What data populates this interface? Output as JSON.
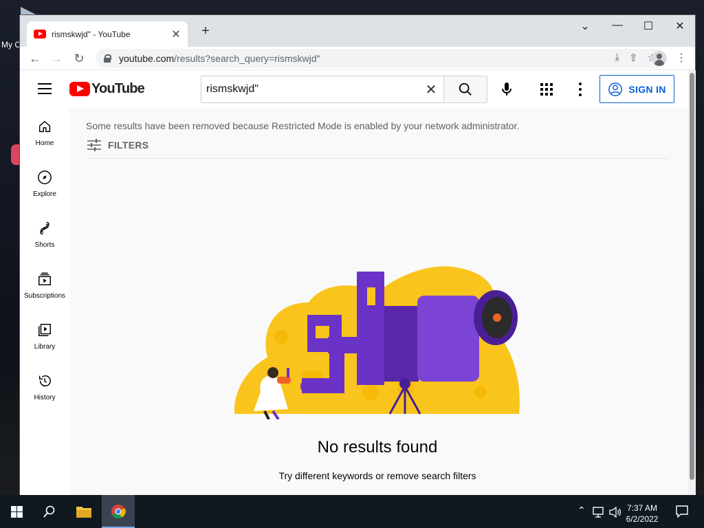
{
  "desktop": {
    "icon_label": "My C"
  },
  "browser": {
    "tab_title": "rismskwjd\" - YouTube",
    "tab_close": "✕",
    "new_tab": "+",
    "url_host": "youtube.com",
    "url_path": "/results?search_query=rismskwjd\"",
    "window_controls": {
      "minimize": "—",
      "maximize": "☐",
      "close": "✕",
      "dropdown": "⌄"
    }
  },
  "youtube": {
    "logo_text": "YouTube",
    "search": {
      "query": "rismskwjd\"",
      "clear": "✕"
    },
    "signin_label": "SIGN IN",
    "sidebar": {
      "items": [
        {
          "label": "Home",
          "icon": "home-icon"
        },
        {
          "label": "Explore",
          "icon": "compass-icon"
        },
        {
          "label": "Shorts",
          "icon": "shorts-icon"
        },
        {
          "label": "Subscriptions",
          "icon": "subscriptions-icon"
        },
        {
          "label": "Library",
          "icon": "library-icon"
        },
        {
          "label": "History",
          "icon": "history-icon"
        }
      ]
    },
    "notice": "Some results have been removed because Restricted Mode is enabled by your network administrator.",
    "filters_label": "FILTERS",
    "empty_title": "No results found",
    "empty_hint": "Try different keywords or remove search filters"
  },
  "taskbar": {
    "time": "7:37 AM",
    "date": "6/2/2022"
  },
  "colors": {
    "youtube_red": "#ff0000",
    "signin_blue": "#065fd4",
    "illus_yellow": "#f9c41c",
    "illus_purple": "#6b32c7"
  }
}
